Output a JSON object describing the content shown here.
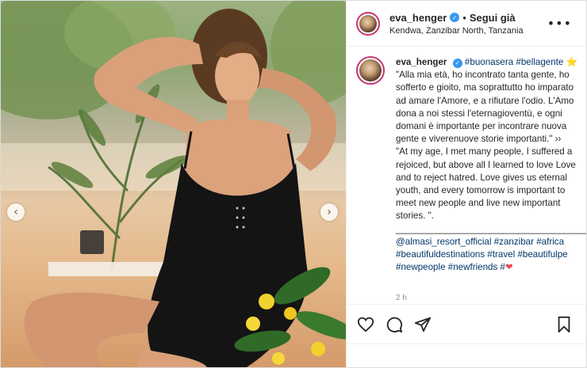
{
  "header": {
    "username": "eva_henger",
    "separator": "•",
    "follow_label": "Segui già",
    "location": "Kendwa, Zanzibar North, Tanzania",
    "more_icon": "more-horizontal-icon",
    "more_glyph": "•••"
  },
  "caption": {
    "username": "eva_henger",
    "hashtags_inline": [
      "#buonasera",
      "#bellagente"
    ],
    "star": "⭐",
    "lines": [
      "\"Alla mia età, ho incontrato tanta gente, ho",
      "sofferto e gioito, ma soprattutto ho imparato",
      "ad amare l'Amore, e a rifiutare l'odio. L'Amo",
      "dona a noi stessi l'eternagioventù, e ogni",
      "domani è importante per incontrare nuova",
      "gente e viverenuove storie importanti.\" ››",
      "\"At my age, I met many people, I suffered a",
      "rejoiced, but above all I learned to love Love",
      "and to reject hatred. Love gives us eternal",
      "youth, and every tomorrow is important to",
      "meet new people and live new important",
      "stories. \".",
      "_________________________________________"
    ],
    "tag_lines": [
      [
        "@almasi_resort_official",
        "#zanzibar",
        "#africa"
      ],
      [
        "#beautifuldestinations",
        "#travel",
        "#beautifulpe"
      ],
      [
        "#newpeople",
        "#newfriends",
        "#"
      ]
    ],
    "heart": "❤",
    "timestamp": "2 h"
  },
  "actions": {
    "like_icon": "heart-icon",
    "comment_icon": "comment-icon",
    "share_icon": "share-icon",
    "save_icon": "bookmark-icon"
  },
  "carousel": {
    "prev_glyph": "‹",
    "next_glyph": "›"
  },
  "colors": {
    "verified": "#3897f0",
    "hashtag": "#00376b",
    "avatar_ring": "#c7356e",
    "heart": "#ed4956"
  }
}
